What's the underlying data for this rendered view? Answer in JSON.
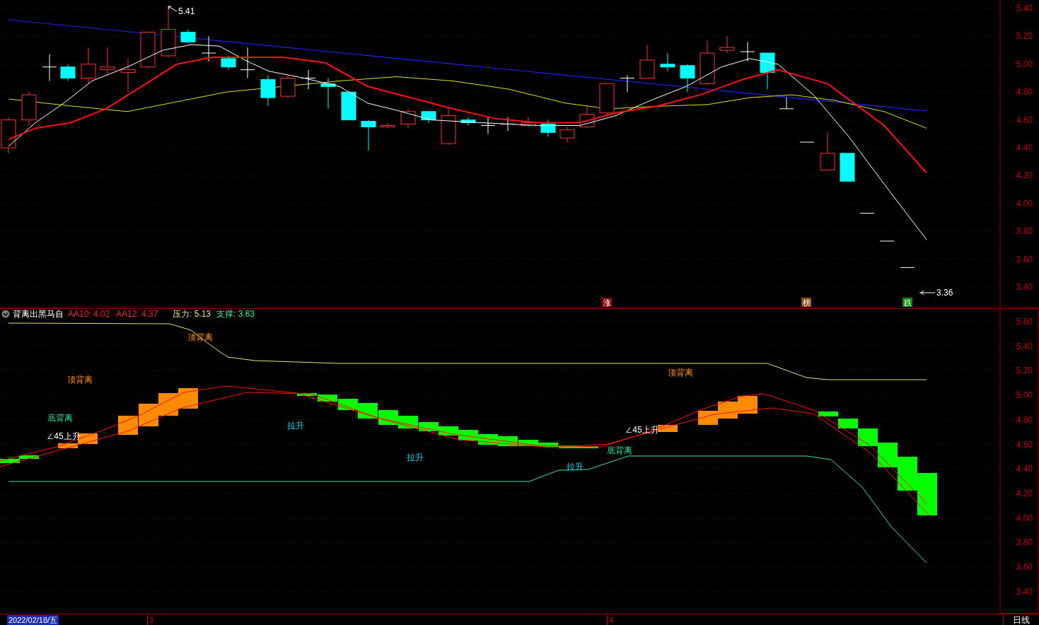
{
  "price_panel": {
    "axis_labels": [
      "5.40",
      "5.20",
      "5.00",
      "4.80",
      "4.60",
      "4.40",
      "4.20",
      "4.00",
      "3.80",
      "3.60",
      "3.40"
    ],
    "high_marker": "5.41",
    "low_marker": "3.36",
    "signal_badges": [
      {
        "text": "涨",
        "color": "#8b0000"
      },
      {
        "text": "榜",
        "color": "#8b4a0c"
      },
      {
        "text": "跌",
        "color": "#0a8a0a"
      }
    ]
  },
  "indicator_panel": {
    "title": "背离出黑马自",
    "values": [
      {
        "text": "AA10: 4.02",
        "color": "#ff2020"
      },
      {
        "text": "AA12: 4.37",
        "color": "#ff2020"
      },
      {
        "text": "压力: 5.13",
        "color": "#e8e080"
      },
      {
        "text": "支撑: 3.63",
        "color": "#40e0a0"
      }
    ],
    "axis_labels": [
      "5.60",
      "5.40",
      "5.20",
      "5.00",
      "4.80",
      "4.60",
      "4.40",
      "4.20",
      "4.00",
      "3.80",
      "3.60",
      "3.40"
    ],
    "annotations": [
      {
        "text": "顶背离",
        "kind": "top"
      },
      {
        "text": "顶背离",
        "kind": "top"
      },
      {
        "text": "顶背离",
        "kind": "top"
      },
      {
        "text": "底背离",
        "kind": "bottom"
      },
      {
        "text": "底背离",
        "kind": "bottom"
      },
      {
        "text": "∠45上升",
        "kind": "angle"
      },
      {
        "text": "∠45上升",
        "kind": "angle"
      },
      {
        "text": "拉升",
        "kind": "pull"
      },
      {
        "text": "拉升",
        "kind": "pull"
      },
      {
        "text": "拉升",
        "kind": "pull"
      }
    ]
  },
  "status_bar": {
    "date": "2022/02/18/五",
    "month_marks": [
      "3",
      "4"
    ],
    "period": "日线"
  }
}
